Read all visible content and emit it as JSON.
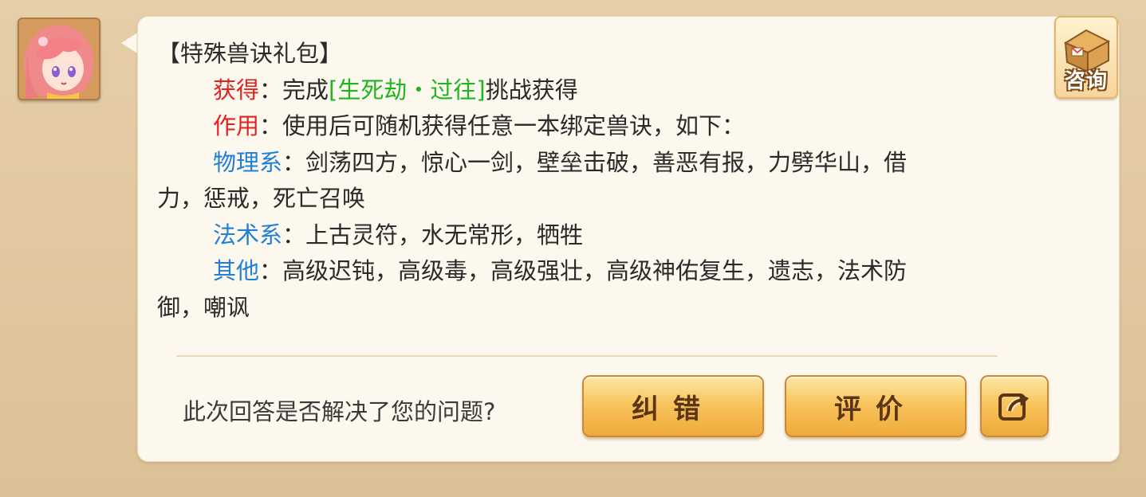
{
  "avatar": {
    "alt": "客服头像"
  },
  "consult": {
    "label": "咨询",
    "icon": "mailbox-icon"
  },
  "message": {
    "title": "【特殊兽诀礼包】",
    "obtain": {
      "label": "获得",
      "sep": "：",
      "prefix": "完成",
      "link": "[生死劫・过往]",
      "suffix": "挑战获得"
    },
    "effect": {
      "label": "作用",
      "sep": "：",
      "text": "使用后可随机获得任意一本绑定兽诀，如下："
    },
    "physical": {
      "label": "物理系",
      "sep": "：",
      "text_line1": "剑荡四方，惊心一剑，壁垒击破，善恶有报，力劈华山，借",
      "text_line2": "力，惩戒，死亡召唤"
    },
    "magic": {
      "label": "法术系",
      "sep": "：",
      "text": "上古灵符，水无常形，牺牲"
    },
    "other": {
      "label": "其他",
      "sep": "：",
      "text_line1": "高级迟钝，高级毒，高级强壮，高级神佑复生，遗志，法术防",
      "text_line2": "御，嘲讽"
    }
  },
  "feedback": {
    "question": "此次回答是否解决了您的问题?",
    "fix_label": "纠错",
    "rate_label": "评价",
    "share_icon": "share-icon"
  },
  "colors": {
    "label_red": "#e02323",
    "label_blue": "#1f7fd9",
    "link_green": "#21b421",
    "button_gold": "#f8c55e"
  }
}
